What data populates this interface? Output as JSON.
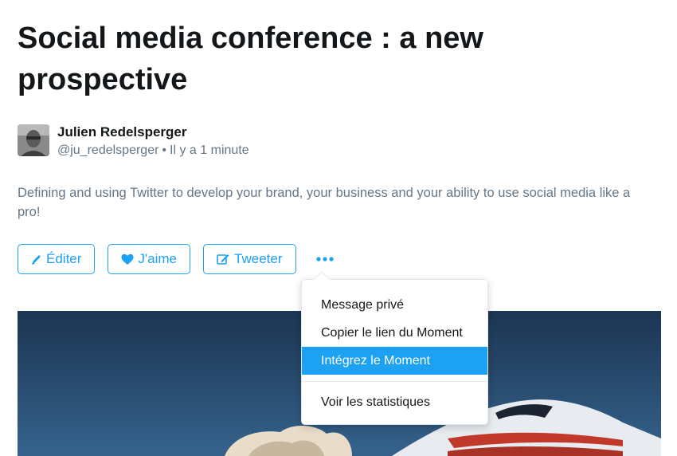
{
  "moment": {
    "title": "Social media conference : a new prospective",
    "author": {
      "name": "Julien Redelsperger",
      "handle": "@ju_redelsperger",
      "separator": "•",
      "time": "Il y a 1 minute"
    },
    "description": "Defining and using Twitter to develop your brand, your business and your ability to use social media like a pro!"
  },
  "actions": {
    "edit_label": "Éditer",
    "like_label": "J'aime",
    "tweet_label": "Tweeter",
    "more_icon": "more-dots-icon"
  },
  "dropdown": {
    "items": [
      {
        "label": "Message privé",
        "active": false
      },
      {
        "label": "Copier le lien du Moment",
        "active": false
      },
      {
        "label": "Intégrez le Moment",
        "active": true
      },
      {
        "label": "Voir les statistiques",
        "active": false
      }
    ]
  },
  "colors": {
    "accent": "#1da1f2",
    "text": "#14171a",
    "muted": "#657786",
    "border": "#e1e8ed"
  }
}
